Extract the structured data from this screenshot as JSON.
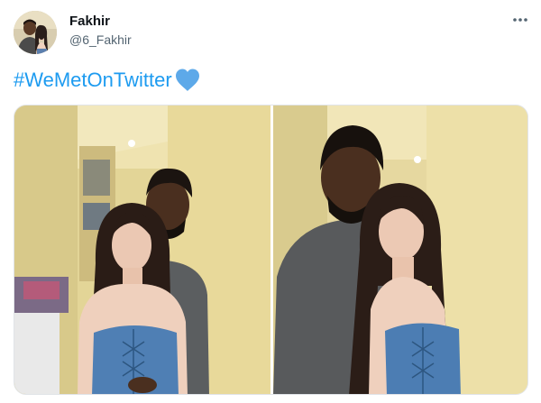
{
  "author": {
    "display_name": "Fakhir",
    "handle": "@6_Fakhir"
  },
  "tweet": {
    "hashtag": "#WeMetOnTwitter",
    "emoji_icon": "blue-heart-icon"
  },
  "colors": {
    "link": "#1d9bf0",
    "name_text": "#0f1419",
    "secondary_text": "#536471",
    "heart": "#5da9e9"
  },
  "media": {
    "photos": [
      {
        "name": "photo-1"
      },
      {
        "name": "photo-2"
      }
    ]
  }
}
